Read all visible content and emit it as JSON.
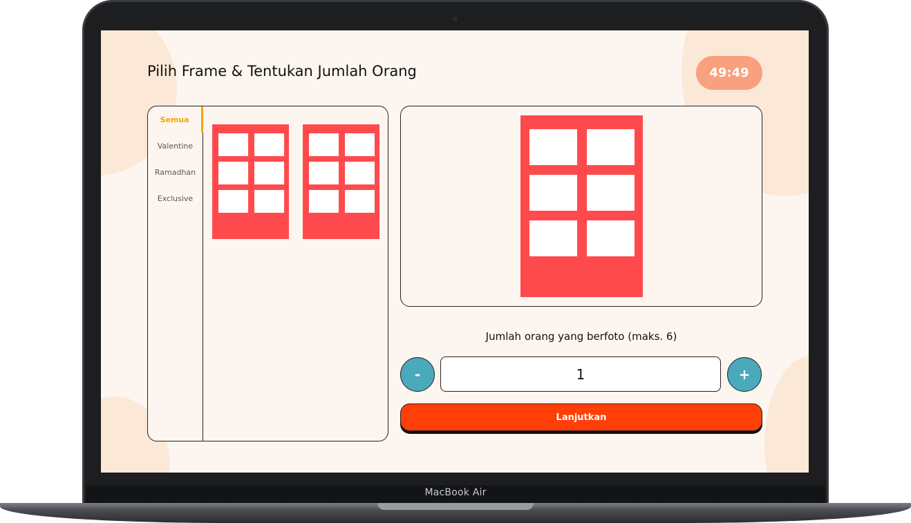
{
  "device": {
    "brand_label": "MacBook Air"
  },
  "header": {
    "title": "Pilih Frame & Tentukan Jumlah Orang",
    "timer": "49:49"
  },
  "categories": [
    {
      "label": "Semua",
      "active": true
    },
    {
      "label": "Valentine",
      "active": false
    },
    {
      "label": "Ramadhan",
      "active": false
    },
    {
      "label": "Exclusive",
      "active": false
    }
  ],
  "frames": [
    {
      "name": "frame-1",
      "cells": 6,
      "color": "#ff4a4d"
    },
    {
      "name": "frame-2",
      "cells": 6,
      "color": "#ff4a4d"
    }
  ],
  "people": {
    "label": "Jumlah orang yang berfoto (maks. 6)",
    "count": "1",
    "decrement_label": "-",
    "increment_label": "+"
  },
  "actions": {
    "continue_label": "Lanjutkan"
  },
  "colors": {
    "accent": "#f5a500",
    "frame_red": "#ff4a4d",
    "timer_bg": "#f9a07e",
    "stepper_teal": "#4ba9bc",
    "continue_orange": "#ff3e08",
    "screen_bg": "#fdf6f0"
  }
}
